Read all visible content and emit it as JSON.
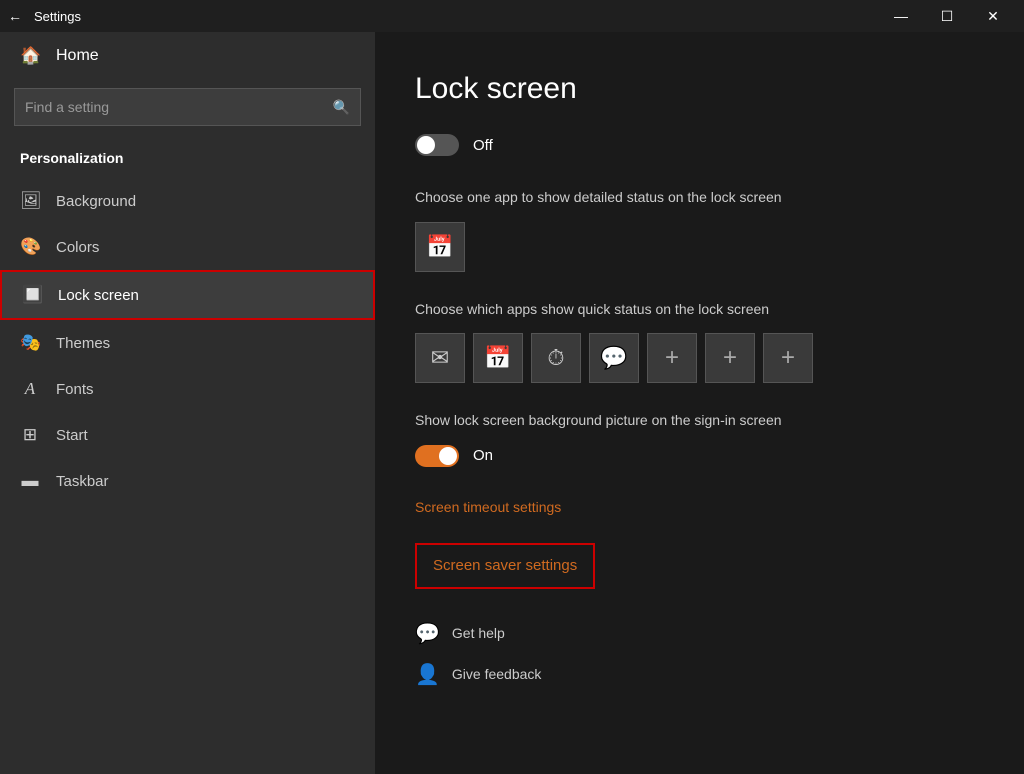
{
  "titlebar": {
    "back_icon": "←",
    "title": "Settings",
    "minimize": "—",
    "maximize": "☐",
    "close": "✕"
  },
  "sidebar": {
    "home_label": "Home",
    "search_placeholder": "Find a setting",
    "search_icon": "🔍",
    "section_title": "Personalization",
    "items": [
      {
        "id": "background",
        "label": "Background",
        "icon": "🖼"
      },
      {
        "id": "colors",
        "label": "Colors",
        "icon": "🎨"
      },
      {
        "id": "lock-screen",
        "label": "Lock screen",
        "icon": "🔲",
        "active": true
      },
      {
        "id": "themes",
        "label": "Themes",
        "icon": "🎭"
      },
      {
        "id": "fonts",
        "label": "Fonts",
        "icon": "A"
      },
      {
        "id": "start",
        "label": "Start",
        "icon": "⊞"
      },
      {
        "id": "taskbar",
        "label": "Taskbar",
        "icon": "▬"
      }
    ]
  },
  "content": {
    "title": "Lock screen",
    "toggle1": {
      "state": "off",
      "label": "Off"
    },
    "detailed_status_label": "Choose one app to show detailed status on the lock screen",
    "detailed_app_icon": "📅",
    "quick_status_label": "Choose which apps show quick status on the lock screen",
    "quick_apps": [
      {
        "icon": "✉",
        "label": "Mail"
      },
      {
        "icon": "📅",
        "label": "Calendar"
      },
      {
        "icon": "⏱",
        "label": "Alarms"
      },
      {
        "icon": "💬",
        "label": "Messaging"
      },
      {
        "icon": "+",
        "label": "Add"
      },
      {
        "icon": "+",
        "label": "Add"
      },
      {
        "icon": "+",
        "label": "Add"
      }
    ],
    "show_bg_label": "Show lock screen background picture on the sign-in screen",
    "toggle2": {
      "state": "on",
      "label": "On"
    },
    "screen_timeout_link": "Screen timeout settings",
    "screen_saver_link": "Screen saver settings",
    "get_help_label": "Get help",
    "give_feedback_label": "Give feedback"
  }
}
